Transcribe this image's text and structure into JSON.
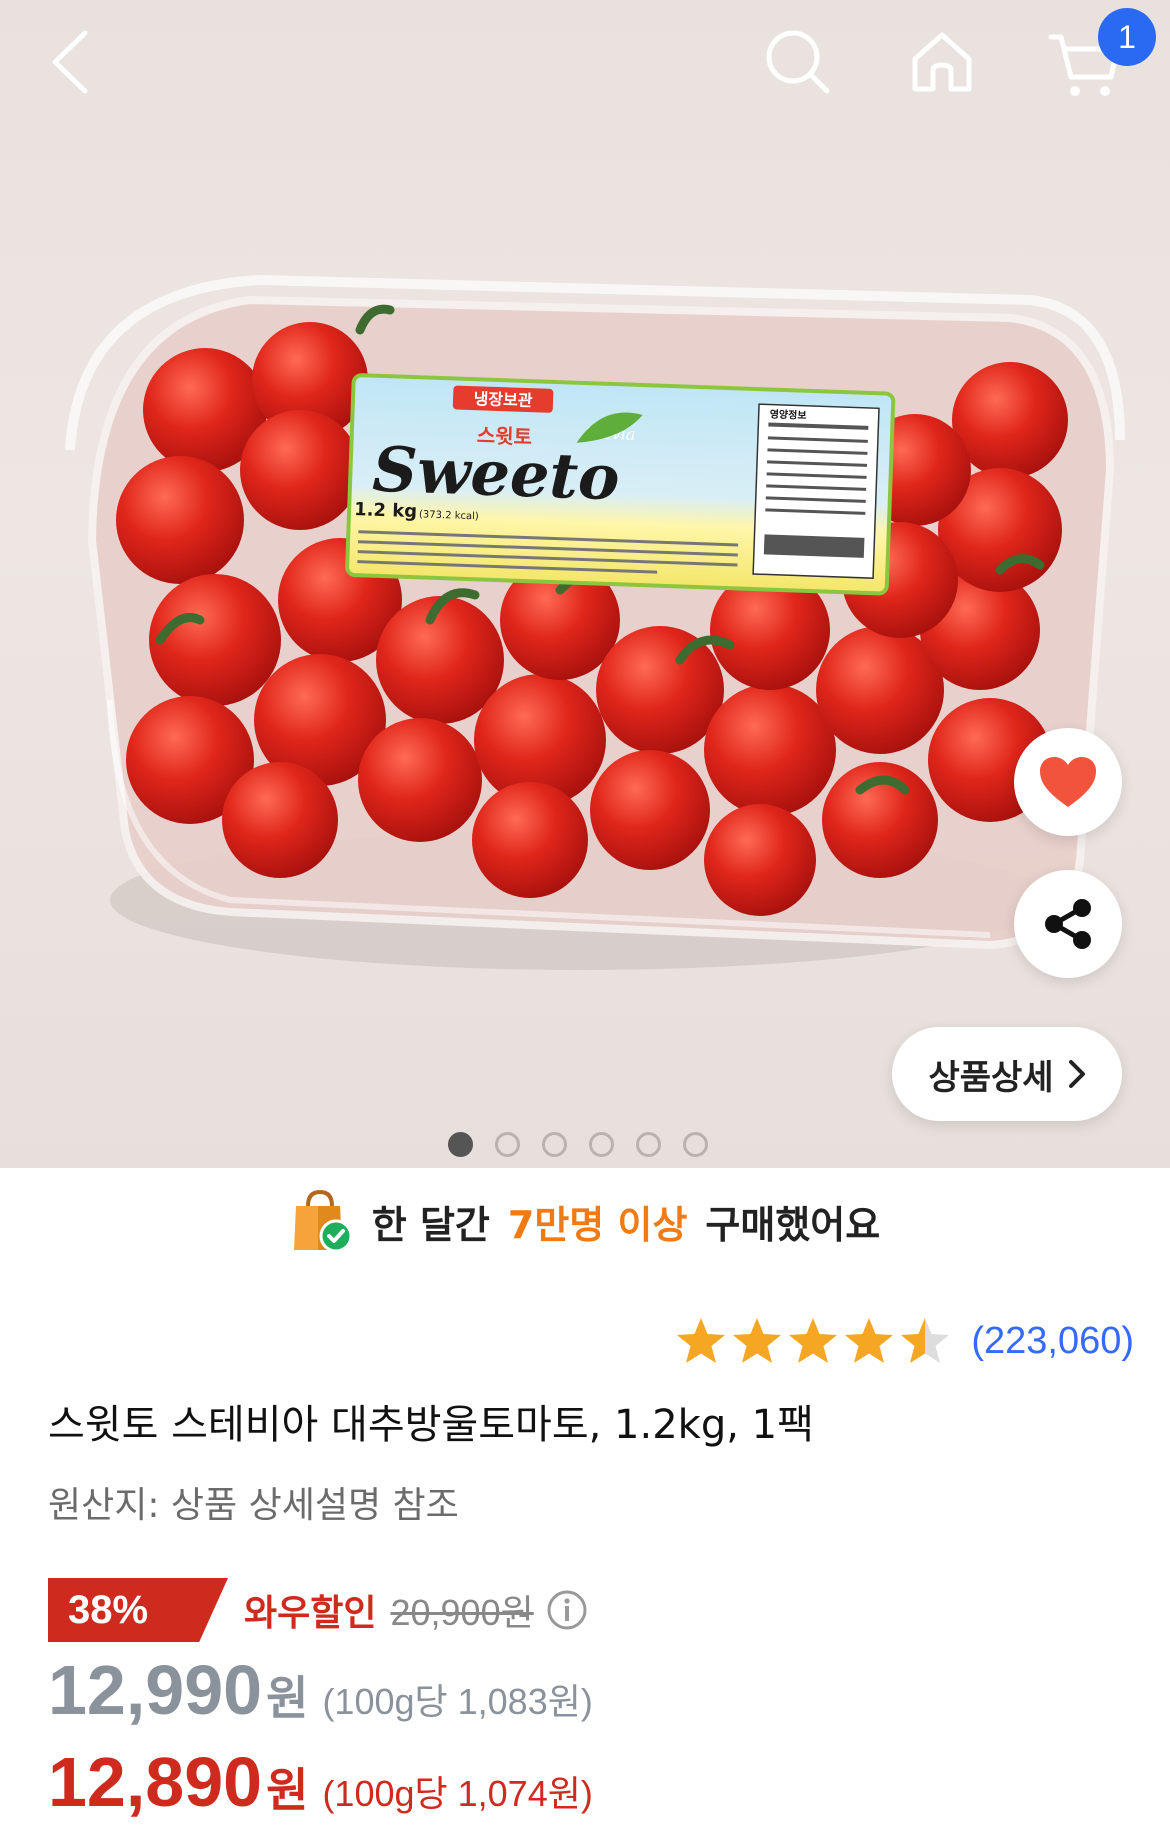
{
  "header": {
    "back_icon": "chevron-left-icon",
    "search_icon": "search-icon",
    "home_icon": "home-icon",
    "cart_icon": "cart-icon",
    "cart_count": "1"
  },
  "gallery": {
    "detail_button_label": "상품상세",
    "total_images": 6,
    "active_index": 0,
    "package_labels": {
      "brand": "Sweeto",
      "brand_kr": "스윗토",
      "storage": "냉장보관",
      "stevia": "Stevia",
      "weight": "1.2 kg",
      "kcal": "(373.2 kcal)",
      "nutrition": "영양정보"
    }
  },
  "purchase_banner": {
    "prefix": "한 달간",
    "highlight": "7만명 이상",
    "suffix": "구매했어요"
  },
  "rating": {
    "stars": 4.5,
    "count": "(223,060)"
  },
  "product": {
    "title": "스윗토 스테비아 대추방울토마토, 1.2kg, 1팩",
    "origin": "원산지: 상품 상세설명 참조"
  },
  "pricing": {
    "discount_percent": "38%",
    "discount_label": "와우할인",
    "original_price": "20,900원",
    "price": "12,990",
    "price_unit": "원",
    "price_per_100g": "(100g당 1,083원)",
    "wow_price": "12,890",
    "wow_price_unit": "원",
    "wow_price_per_100g": "(100g당 1,074원)"
  },
  "colors": {
    "accent_red": "#cf2a1e",
    "accent_orange": "#f07a14",
    "link_blue": "#346aff",
    "star_gold": "#f5a623"
  }
}
